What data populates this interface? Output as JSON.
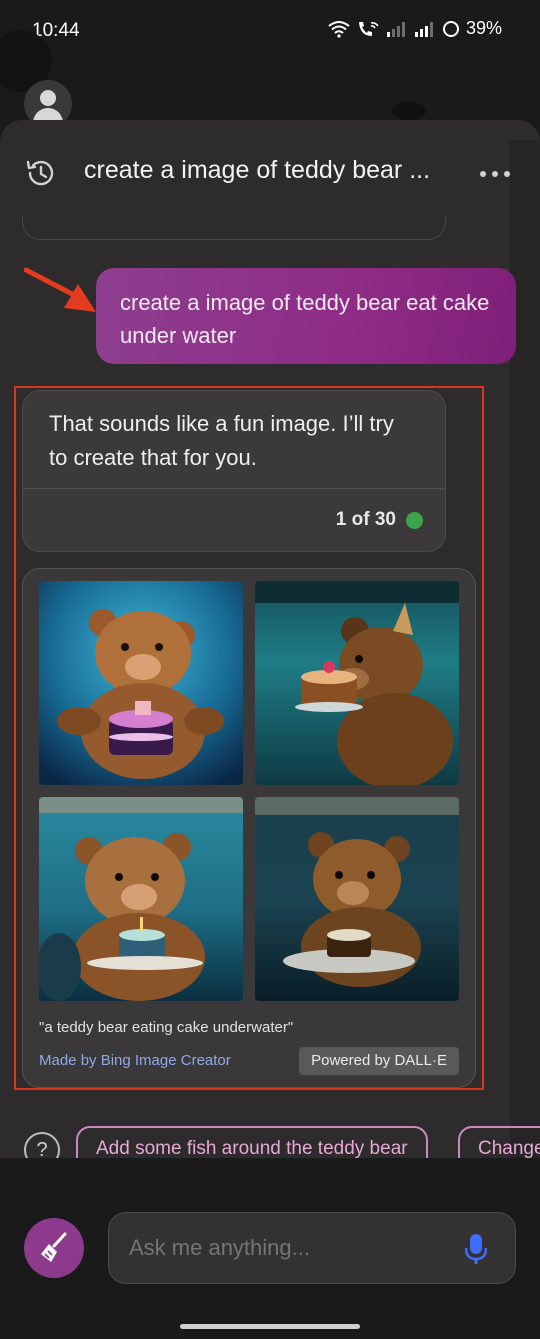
{
  "status_bar": {
    "time": "10:44",
    "battery": "39%",
    "icons": [
      "wifi-icon",
      "wifi-calling-icon",
      "signal-icon",
      "signal-icon",
      "battery-icon"
    ]
  },
  "header": {
    "title": "create a image of teddy bear ...",
    "history_icon": "history-icon",
    "more_icon": "more-horizontal-icon"
  },
  "user_message": {
    "text": "create a image of teddy bear eat cake under water"
  },
  "bot_message": {
    "text": "That sounds like a fun image. I’ll try to create that for you.",
    "counter": "1 of 30",
    "status_color": "#3aa54a"
  },
  "image_result": {
    "images": [
      {
        "description": "teddy bear with cake"
      },
      {
        "description": "teddy bear with party hat and cake"
      },
      {
        "description": "teddy bear with candle cake"
      },
      {
        "description": "dark teddy bear with cake"
      }
    ],
    "caption": "\"a teddy bear eating cake underwater\"",
    "made_by": "Made by Bing Image Creator",
    "powered_by": "Powered by DALL·E"
  },
  "suggestions": {
    "help_icon": "?",
    "chips": [
      "Add some fish around the teddy bear",
      "Change"
    ]
  },
  "composer": {
    "placeholder": "Ask me anything...",
    "new_topic_icon": "broom-icon",
    "mic_icon": "microphone-icon"
  },
  "colors": {
    "user_bubble": "#8d3e8f",
    "accent_chip": "#e7a8d5",
    "highlight_box": "#d7381c",
    "link": "#8fa9e6"
  }
}
